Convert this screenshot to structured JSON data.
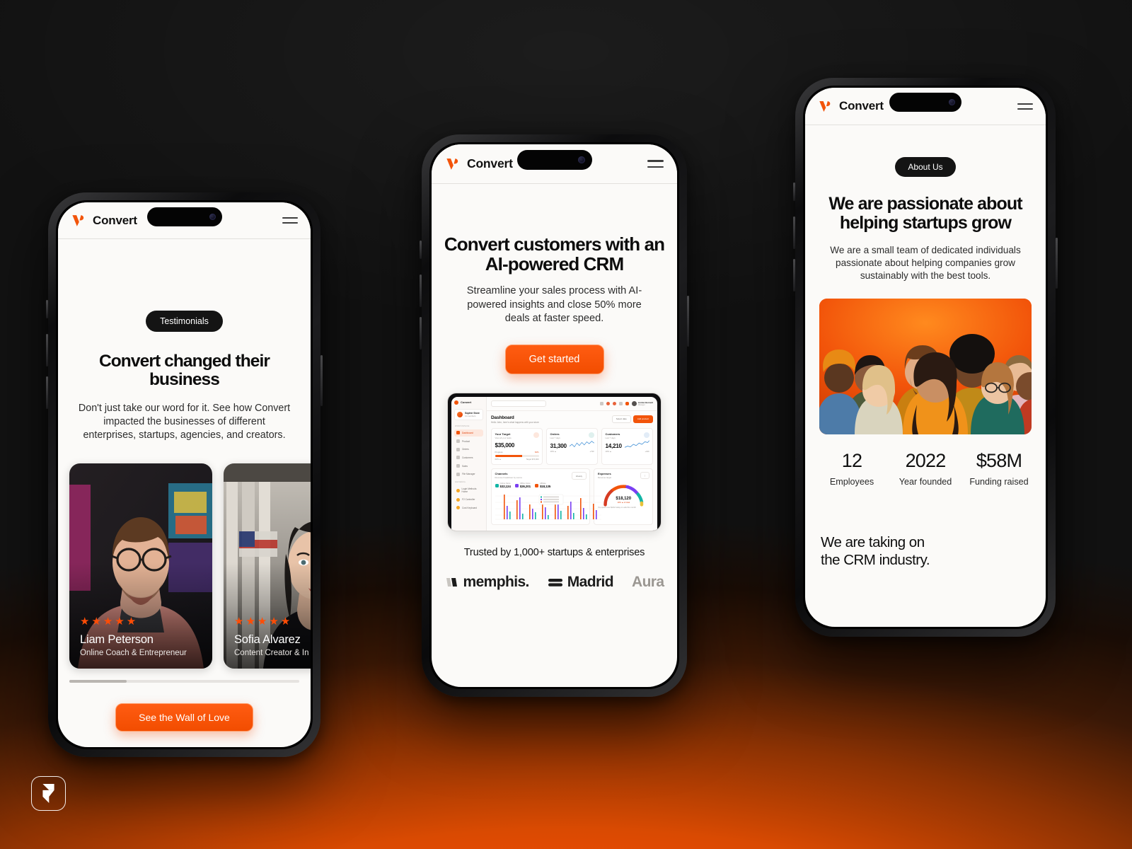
{
  "brand": {
    "name": "Convert",
    "accent": "#f2540a",
    "logo_icon": "convert-v-logo"
  },
  "background": {
    "top_color": "#121212",
    "bottom_color": "#ff4d00"
  },
  "badge": {
    "name": "framer-badge",
    "icon": "framer-logo-icon"
  },
  "phones": {
    "left": {
      "header": {
        "brand": "Convert",
        "menu_icon": "hamburger-menu-icon"
      },
      "eyebrow": "Testimonials",
      "heading": "Convert changed their business",
      "subheading": "Don't just take our word for it. See how Convert impacted the businesses of different enterprises, startups, agencies, and creators.",
      "testimonials": [
        {
          "name": "Liam Peterson",
          "role": "Online Coach & Entrepreneur",
          "stars": "★★★★★",
          "rating": 5
        },
        {
          "name": "Sofia Alvarez",
          "role": "Content Creator & In",
          "stars": "★★★★★",
          "rating": 5
        }
      ],
      "cta": "See the Wall of Love"
    },
    "center": {
      "header": {
        "brand": "Convert",
        "menu_icon": "hamburger-menu-icon"
      },
      "heading": "Convert customers with an AI-powered CRM",
      "subheading": "Streamline your sales process with AI-powered insights and close 50% more deals at faster speed.",
      "cta": "Get started",
      "trusted_text": "Trusted by 1,000+ startups & enterprises",
      "logos": [
        "memphis.",
        "Madrid",
        "Aura"
      ],
      "dashboard": {
        "brand": "Convert",
        "store": {
          "name": "Sophie Store",
          "meta": "11 members"
        },
        "search_placeholder": "Search...",
        "user": {
          "name": "Jordan Bennett",
          "role": "Manager"
        },
        "nav_group_1_label": "WORKSPACE",
        "nav_group_1": [
          "Dashboard",
          "Product",
          "Orders",
          "Customers",
          "Sales",
          "File Manager"
        ],
        "nav_group_2_label": "GENERAL",
        "nav_group_2": [
          "Login Methods Home",
          "F2 Controller",
          "Cost Keyboard"
        ],
        "title": "Dashboard",
        "subtitle": "Hello John, here's what happens with your store",
        "buttons": {
          "secondary": "Select date",
          "primary": "Add product"
        },
        "cards": [
          {
            "title": "Your Target",
            "meta": "View all your tasks",
            "value": "$35,000",
            "progress_label": "Progress",
            "progress_pct": "62%",
            "foot_left": "62% ▲",
            "foot_right": "Target $70,000"
          },
          {
            "title": "Orders",
            "meta": "Last 7 days",
            "value": "31,300",
            "foot_left": "10% ▲",
            "foot_right": "+730"
          },
          {
            "title": "Customers",
            "meta": "Last 7 days",
            "value": "14,210",
            "foot_left": "10% ▲",
            "foot_right": "+340"
          }
        ],
        "channels": {
          "title": "Channels",
          "subtitle": "Revenue breakdown by source",
          "select": "Weekly",
          "legend": [
            {
              "label": "Online Store",
              "value": "$32,124",
              "delta": "10% ▲",
              "color": "#12b5a5"
            },
            {
              "label": "Offline Store",
              "value": "$26,201",
              "delta": "5% ▲",
              "color": "#7a3ff2"
            },
            {
              "label": "Affiliate",
              "value": "$18,135",
              "delta": "6% ▲",
              "color": "#f2540a"
            }
          ],
          "tooltip": [
            "Online $32K",
            "Offline $26K",
            "Affiliate $18K"
          ]
        },
        "expenses": {
          "title": "Expenses",
          "subtitle": "Revenue target",
          "value": "$18,120",
          "delta": "10% ▲ of total",
          "note": "You spent over $242 today on ads this month"
        }
      }
    },
    "right": {
      "header": {
        "brand": "Convert",
        "menu_icon": "hamburger-menu-icon"
      },
      "eyebrow": "About Us",
      "heading": "We are passionate about helping startups grow",
      "subheading": "We are a small team of dedicated individuals passionate about helping companies grow sustainably with the best tools.",
      "team_photo_alt": "team-group-photo",
      "stats": [
        {
          "value": "12",
          "label": "Employees"
        },
        {
          "value": "2022",
          "label": "Year founded"
        },
        {
          "value": "$58M",
          "label": "Funding raised"
        }
      ],
      "closing": "We are taking on\nthe CRM industry."
    }
  }
}
